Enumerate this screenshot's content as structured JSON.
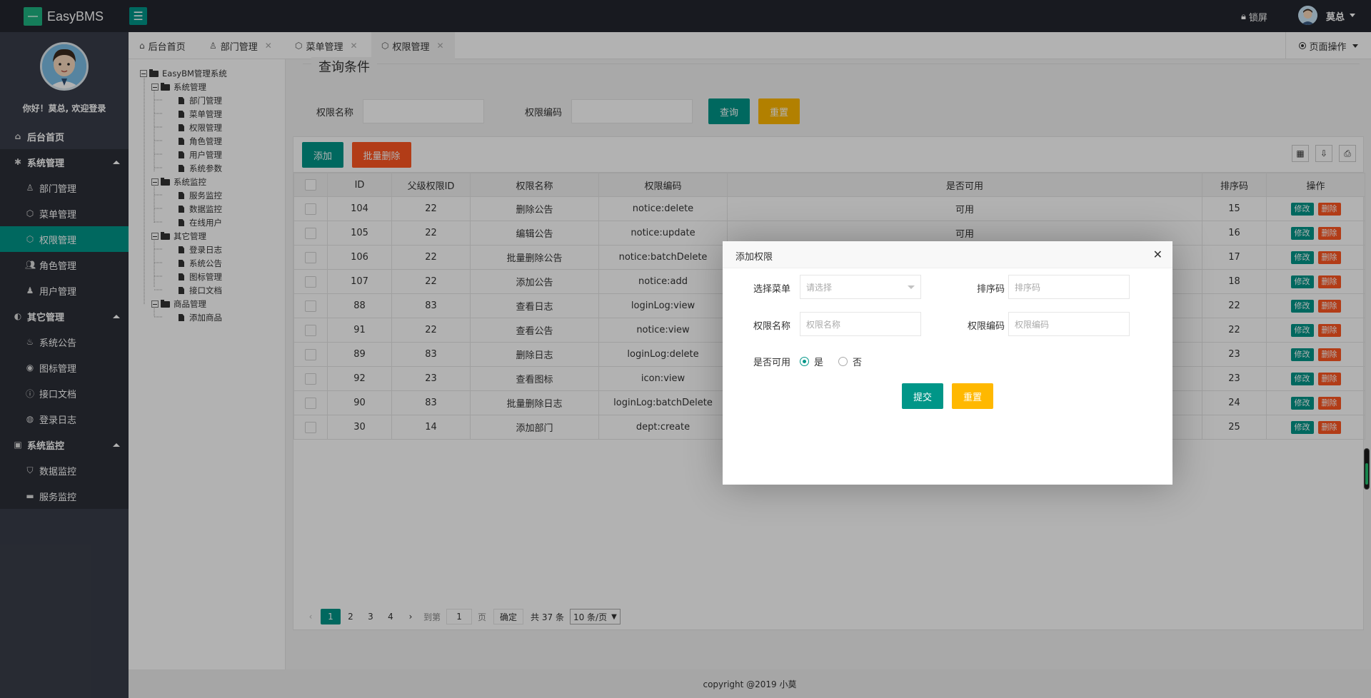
{
  "app": {
    "title": "EasyBMS",
    "lock_label": "锁屏",
    "user_name": "莫总",
    "welcome": "你好！莫总, 欢迎登录"
  },
  "colors": {
    "accent": "#009688",
    "warn": "#ffb800",
    "danger": "#ff5722",
    "header": "#23262e",
    "sidebar": "#393d49"
  },
  "sidebar": {
    "home": "后台首页",
    "groups": [
      {
        "label": "系统管理",
        "items": [
          "部门管理",
          "菜单管理",
          "权限管理",
          "角色管理",
          "用户管理"
        ]
      },
      {
        "label": "其它管理",
        "items": [
          "系统公告",
          "图标管理",
          "接口文档",
          "登录日志"
        ]
      },
      {
        "label": "系统监控",
        "items": [
          "数据监控",
          "服务监控"
        ]
      }
    ],
    "active": "权限管理"
  },
  "tabs": [
    {
      "label": "后台首页"
    },
    {
      "label": "部门管理"
    },
    {
      "label": "菜单管理"
    },
    {
      "label": "权限管理"
    }
  ],
  "page_ops": "页面操作",
  "tree": {
    "root": "EasyBM管理系统",
    "nodes": [
      {
        "label": "系统管理",
        "children": [
          "部门管理",
          "菜单管理",
          "权限管理",
          "角色管理",
          "用户管理",
          "系统参数"
        ]
      },
      {
        "label": "系统监控",
        "children": [
          "服务监控",
          "数据监控",
          "在线用户"
        ]
      },
      {
        "label": "其它管理",
        "children": [
          "登录日志",
          "系统公告",
          "图标管理",
          "接口文档"
        ]
      },
      {
        "label": "商品管理",
        "children": [
          "添加商品"
        ]
      }
    ]
  },
  "query": {
    "legend": "查询条件",
    "name_label": "权限名称",
    "code_label": "权限编码",
    "search_btn": "查询",
    "reset_btn": "重置"
  },
  "toolbar": {
    "add": "添加",
    "batch_delete": "批量删除"
  },
  "table": {
    "headers": [
      "ID",
      "父级权限ID",
      "权限名称",
      "权限编码",
      "是否可用",
      "排序码",
      "操作"
    ],
    "edit_label": "修改",
    "delete_label": "删除",
    "rows": [
      {
        "id": "104",
        "pid": "22",
        "name": "删除公告",
        "code": "notice:delete",
        "avail": "可用",
        "sort": "15"
      },
      {
        "id": "105",
        "pid": "22",
        "name": "编辑公告",
        "code": "notice:update",
        "avail": "可用",
        "sort": "16"
      },
      {
        "id": "106",
        "pid": "22",
        "name": "批量删除公告",
        "code": "notice:batchDelete",
        "avail": "",
        "sort": "17"
      },
      {
        "id": "107",
        "pid": "22",
        "name": "添加公告",
        "code": "notice:add",
        "avail": "",
        "sort": "18"
      },
      {
        "id": "88",
        "pid": "83",
        "name": "查看日志",
        "code": "loginLog:view",
        "avail": "",
        "sort": "22"
      },
      {
        "id": "91",
        "pid": "22",
        "name": "查看公告",
        "code": "notice:view",
        "avail": "",
        "sort": "22"
      },
      {
        "id": "89",
        "pid": "83",
        "name": "删除日志",
        "code": "loginLog:delete",
        "avail": "",
        "sort": "23"
      },
      {
        "id": "92",
        "pid": "23",
        "name": "查看图标",
        "code": "icon:view",
        "avail": "",
        "sort": "23"
      },
      {
        "id": "90",
        "pid": "83",
        "name": "批量删除日志",
        "code": "loginLog:batchDelete",
        "avail": "",
        "sort": "24"
      },
      {
        "id": "30",
        "pid": "14",
        "name": "添加部门",
        "code": "dept:create",
        "avail": "",
        "sort": "25"
      }
    ]
  },
  "pager": {
    "pages": [
      "1",
      "2",
      "3",
      "4"
    ],
    "current": "1",
    "goto_prefix": "到第",
    "goto_value": "1",
    "goto_suffix": "页",
    "confirm": "确定",
    "total": "共 37 条",
    "per_page": "10 条/页"
  },
  "footer": "copyright @2019 小莫",
  "modal": {
    "title": "添加权限",
    "menu_label": "选择菜单",
    "menu_placeholder": "请选择",
    "sort_label": "排序码",
    "sort_placeholder": "排序码",
    "name_label": "权限名称",
    "name_placeholder": "权限名称",
    "code_label": "权限编码",
    "code_placeholder": "权限编码",
    "avail_label": "是否可用",
    "yes": "是",
    "no": "否",
    "submit": "提交",
    "reset": "重置"
  }
}
